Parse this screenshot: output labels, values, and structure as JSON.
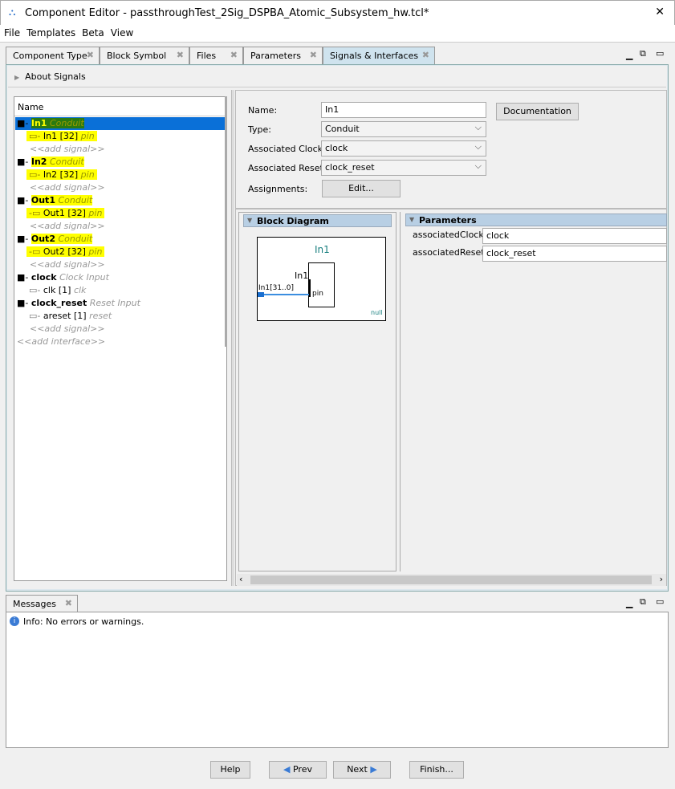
{
  "window": {
    "title": "Component Editor - passthroughTest_2Sig_DSPBA_Atomic_Subsystem_hw.tcl*",
    "close": "✕"
  },
  "menu": [
    "File",
    "Templates",
    "Beta",
    "View"
  ],
  "tabs": [
    {
      "label": "Component Type"
    },
    {
      "label": "Block Symbol"
    },
    {
      "label": "Files"
    },
    {
      "label": "Parameters"
    },
    {
      "label": "Signals & Interfaces",
      "active": true
    }
  ],
  "about": "About Signals",
  "tree": {
    "header": "Name",
    "rows": [
      {
        "kind": "iface",
        "name": "In1",
        "type": "Conduit",
        "selected": true
      },
      {
        "kind": "sig",
        "dir": "in",
        "name": "In1 [32]",
        "role": "pin",
        "hl": true
      },
      {
        "kind": "add",
        "name": "<<add signal>>"
      },
      {
        "kind": "iface",
        "name": "In2",
        "type": "Conduit",
        "hl": true
      },
      {
        "kind": "sig",
        "dir": "in",
        "name": "In2 [32]",
        "role": "pin",
        "hl": true
      },
      {
        "kind": "add",
        "name": "<<add signal>>"
      },
      {
        "kind": "iface",
        "name": "Out1",
        "type": "Conduit",
        "hl": true
      },
      {
        "kind": "sig",
        "dir": "out",
        "name": "Out1 [32]",
        "role": "pin",
        "hl": true
      },
      {
        "kind": "add",
        "name": "<<add signal>>"
      },
      {
        "kind": "iface",
        "name": "Out2",
        "type": "Conduit",
        "hl": true
      },
      {
        "kind": "sig",
        "dir": "out",
        "name": "Out2 [32]",
        "role": "pin",
        "hl": true
      },
      {
        "kind": "add",
        "name": "<<add signal>>"
      },
      {
        "kind": "iface",
        "name": "clock",
        "type": "Clock Input"
      },
      {
        "kind": "sig",
        "dir": "in",
        "name": "clk [1]",
        "role": "clk"
      },
      {
        "kind": "iface",
        "name": "clock_reset",
        "type": "Reset Input"
      },
      {
        "kind": "sig",
        "dir": "in",
        "name": "areset [1]",
        "role": "reset"
      },
      {
        "kind": "add",
        "name": "<<add signal>>"
      },
      {
        "kind": "addif",
        "name": "<<add interface>>"
      }
    ]
  },
  "form": {
    "name_label": "Name:",
    "name_value": "In1",
    "type_label": "Type:",
    "type_value": "Conduit",
    "clock_label": "Associated Clock:",
    "clock_value": "clock",
    "reset_label": "Associated Reset:",
    "reset_value": "clock_reset",
    "assign_label": "Assignments:",
    "edit_button": "Edit...",
    "doc_button": "Documentation"
  },
  "block_diagram": {
    "title": "Block Diagram",
    "name": "In1",
    "iface": "In1",
    "port": "In1[31..0]",
    "pin": "pin",
    "footer": "null"
  },
  "parameters": {
    "title": "Parameters",
    "rows": [
      {
        "label": "associatedClock:",
        "value": "clock"
      },
      {
        "label": "associatedReset:",
        "value": "clock_reset"
      }
    ]
  },
  "messages": {
    "tab": "Messages",
    "text": "Info: No errors or warnings."
  },
  "buttons": {
    "help": "Help",
    "prev": "Prev",
    "next": "Next",
    "finish": "Finish..."
  }
}
